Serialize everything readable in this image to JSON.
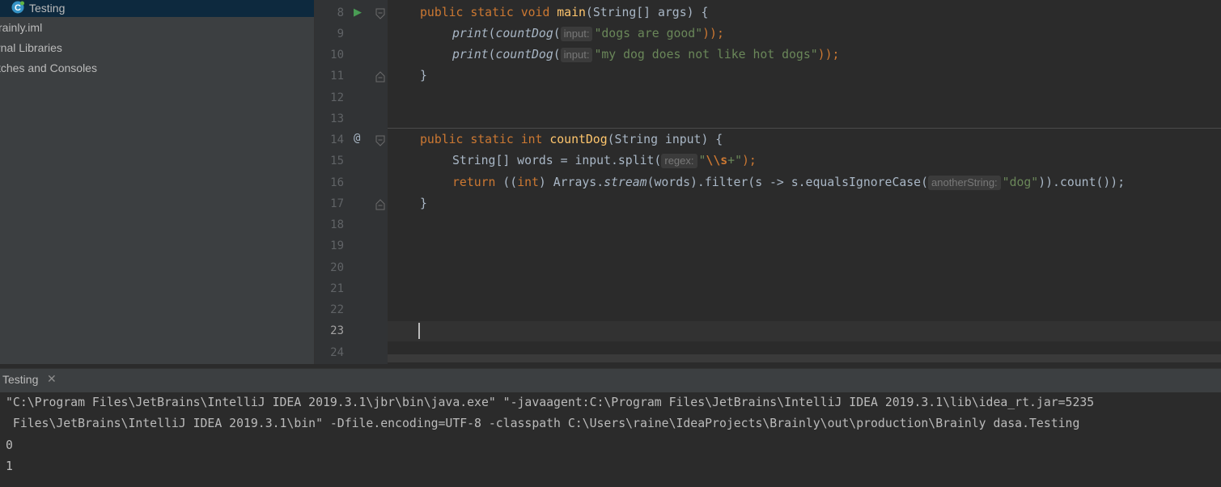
{
  "project_tree": {
    "items": [
      {
        "label": "Testing"
      },
      {
        "label": "rainly.iml"
      },
      {
        "label": "rnal Libraries"
      },
      {
        "label": "tches and Consoles"
      }
    ]
  },
  "editor": {
    "line_numbers": [
      "8",
      "9",
      "10",
      "11",
      "12",
      "13",
      "14",
      "15",
      "16",
      "17",
      "18",
      "19",
      "20",
      "21",
      "22",
      "23",
      "24"
    ],
    "code": {
      "l8": {
        "kw": "public static void ",
        "fn": "main",
        "rest": "(String[] args) {"
      },
      "l9": {
        "fn1": "print",
        "fn2": "countDog",
        "hint": "input:",
        "str": "\"dogs are good\"",
        "end": "));"
      },
      "l10": {
        "fn1": "print",
        "fn2": "countDog",
        "hint": "input:",
        "str": "\"my dog does not like hot dogs\"",
        "end": "));"
      },
      "l11": "}",
      "l14": {
        "kw1": "public static ",
        "kw2": "int ",
        "fn": "countDog",
        "rest": "(String input) {"
      },
      "l15": {
        "pre": "String[] words = input.split(",
        "hint": "regex:",
        "q1": "\"",
        "esc": "\\\\s",
        "plus": "+",
        "q2": "\"",
        "end": ");"
      },
      "l16": {
        "kw": "return ",
        "p1": "((",
        "kw2": "int",
        "p2": ") Arrays.",
        "it": "stream",
        "p3": "(words).filter(s -> s.equalsIgnoreCase(",
        "hint": "anotherString:",
        "str": "\"dog\"",
        "end": ")).count());"
      },
      "l17": "}"
    },
    "gutter_marks": {
      "run": "▶",
      "override": "@"
    }
  },
  "run_panel": {
    "tab_label": "Testing",
    "close_glyph": "✕",
    "output_lines": [
      "\"C:\\Program Files\\JetBrains\\IntelliJ IDEA 2019.3.1\\jbr\\bin\\java.exe\" \"-javaagent:C:\\Program Files\\JetBrains\\IntelliJ IDEA 2019.3.1\\lib\\idea_rt.jar=5235",
      " Files\\JetBrains\\IntelliJ IDEA 2019.3.1\\bin\" -Dfile.encoding=UTF-8 -classpath C:\\Users\\raine\\IdeaProjects\\Brainly\\out\\production\\Brainly dasa.Testing",
      "0",
      "1"
    ]
  },
  "colors": {
    "keyword": "#cc7832",
    "function": "#ffc66d",
    "string": "#6a8759",
    "text": "#a9b7c6"
  }
}
